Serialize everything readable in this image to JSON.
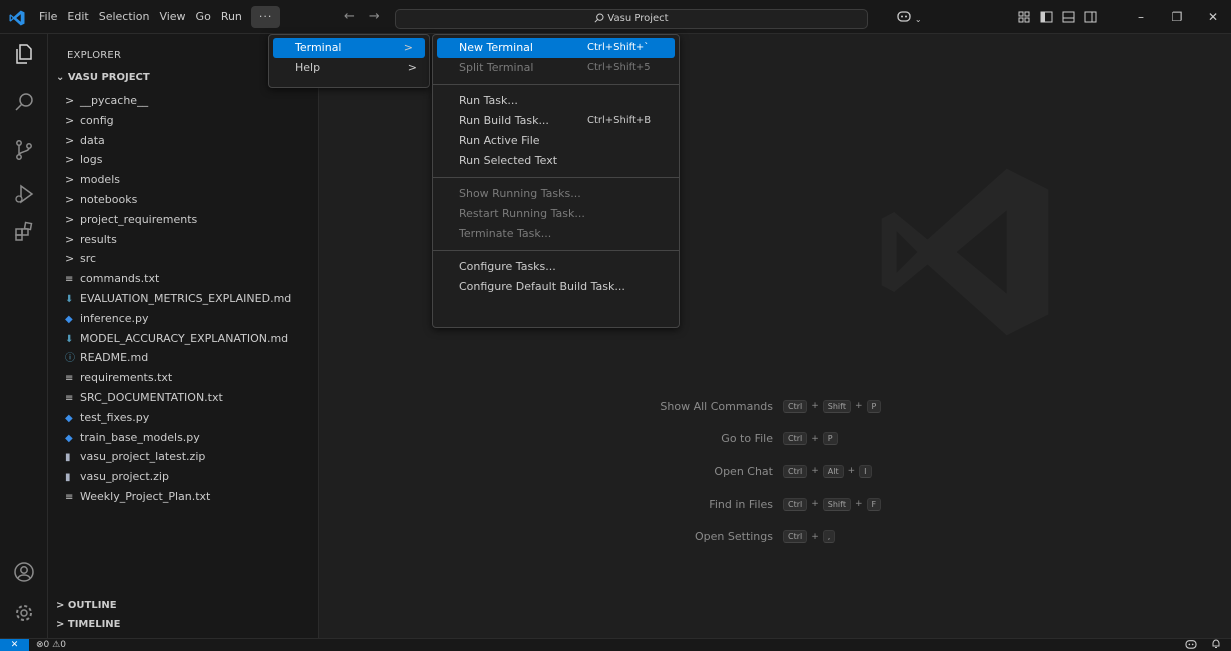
{
  "menubar": {
    "items": [
      "File",
      "Edit",
      "Selection",
      "View",
      "Go",
      "Run"
    ],
    "overflow": "···"
  },
  "nav": {
    "back": "←",
    "forward": "→"
  },
  "search": {
    "text": "Vasu Project"
  },
  "window": {
    "minimize": "–",
    "restore": "❐",
    "close": "✕"
  },
  "sidebar": {
    "title": "EXPLORER",
    "project": "VASU PROJECT",
    "items": [
      {
        "label": "__pycache__",
        "kind": "folder"
      },
      {
        "label": "config",
        "kind": "folder"
      },
      {
        "label": "data",
        "kind": "folder"
      },
      {
        "label": "logs",
        "kind": "folder"
      },
      {
        "label": "models",
        "kind": "folder"
      },
      {
        "label": "notebooks",
        "kind": "folder"
      },
      {
        "label": "project_requirements",
        "kind": "folder"
      },
      {
        "label": "results",
        "kind": "folder"
      },
      {
        "label": "src",
        "kind": "folder"
      },
      {
        "label": "commands.txt",
        "kind": "txt"
      },
      {
        "label": "EVALUATION_METRICS_EXPLAINED.md",
        "kind": "md"
      },
      {
        "label": "inference.py",
        "kind": "py"
      },
      {
        "label": "MODEL_ACCURACY_EXPLANATION.md",
        "kind": "md"
      },
      {
        "label": "README.md",
        "kind": "info"
      },
      {
        "label": "requirements.txt",
        "kind": "txt"
      },
      {
        "label": "SRC_DOCUMENTATION.txt",
        "kind": "txt"
      },
      {
        "label": "test_fixes.py",
        "kind": "py"
      },
      {
        "label": "train_base_models.py",
        "kind": "py"
      },
      {
        "label": "vasu_project_latest.zip",
        "kind": "zip"
      },
      {
        "label": "vasu_project.zip",
        "kind": "zip"
      },
      {
        "label": "Weekly_Project_Plan.txt",
        "kind": "txt"
      }
    ],
    "outline": "OUTLINE",
    "timeline": "TIMELINE"
  },
  "overflow_menu": {
    "items": [
      {
        "label": "Terminal",
        "arrow": ">"
      },
      {
        "label": "Help",
        "arrow": ">"
      }
    ]
  },
  "terminal_menu": {
    "groups": [
      [
        {
          "label": "New Terminal",
          "shortcut": "Ctrl+Shift+`",
          "state": "active"
        },
        {
          "label": "Split Terminal",
          "shortcut": "Ctrl+Shift+5",
          "state": "disabled"
        }
      ],
      [
        {
          "label": "Run Task...",
          "shortcut": "",
          "state": "normal"
        },
        {
          "label": "Run Build Task...",
          "shortcut": "Ctrl+Shift+B",
          "state": "normal"
        },
        {
          "label": "Run Active File",
          "shortcut": "",
          "state": "normal"
        },
        {
          "label": "Run Selected Text",
          "shortcut": "",
          "state": "normal"
        }
      ],
      [
        {
          "label": "Show Running Tasks...",
          "shortcut": "",
          "state": "disabled"
        },
        {
          "label": "Restart Running Task...",
          "shortcut": "",
          "state": "disabled"
        },
        {
          "label": "Terminate Task...",
          "shortcut": "",
          "state": "disabled"
        }
      ],
      [
        {
          "label": "Configure Tasks...",
          "shortcut": "",
          "state": "normal"
        },
        {
          "label": "Configure Default Build Task...",
          "shortcut": "",
          "state": "normal"
        }
      ]
    ]
  },
  "shortcuts": [
    {
      "label": "Show All Commands",
      "keys": [
        "Ctrl",
        "Shift",
        "P"
      ]
    },
    {
      "label": "Go to File",
      "keys": [
        "Ctrl",
        "P"
      ]
    },
    {
      "label": "Open Chat",
      "keys": [
        "Ctrl",
        "Alt",
        "I"
      ]
    },
    {
      "label": "Find in Files",
      "keys": [
        "Ctrl",
        "Shift",
        "F"
      ]
    },
    {
      "label": "Open Settings",
      "keys": [
        "Ctrl",
        ","
      ]
    }
  ],
  "statusbar": {
    "remote": "✕",
    "errors": "0",
    "warnings": "0"
  },
  "colors": {
    "accent": "#0078d4",
    "md_icon": "#519aba",
    "py_icon": "#3b8eea",
    "zip_icon": "#a9b1c3",
    "info_icon": "#519aba"
  }
}
